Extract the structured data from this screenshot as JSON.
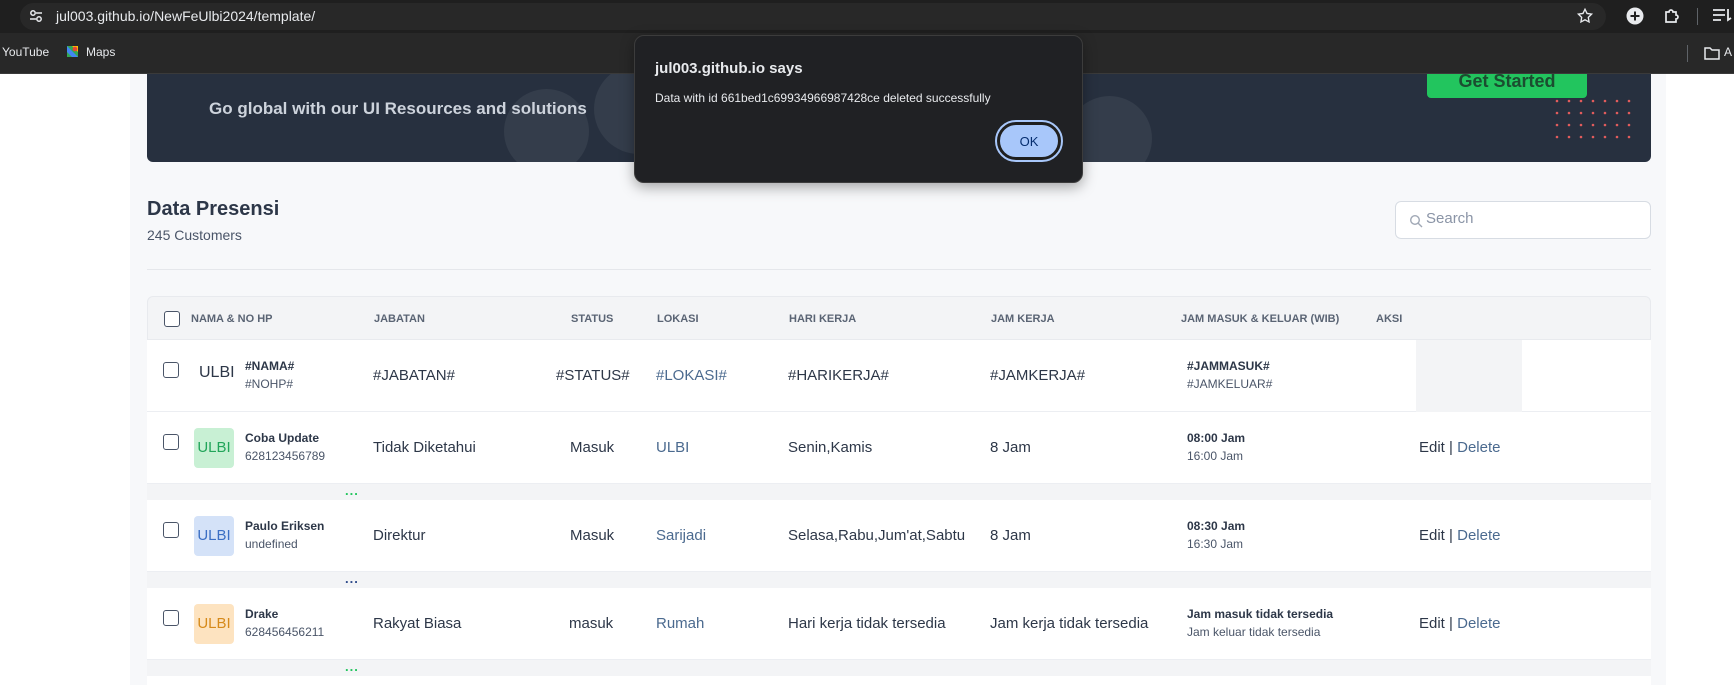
{
  "browser": {
    "url": "jul003.github.io/NewFeUlbi2024/template/",
    "bookmarks": [
      "YouTube",
      "Maps"
    ],
    "bookmark_overflow": "A"
  },
  "banner": {
    "text": "Go global with our UI Resources and solutions",
    "button_label": "Get Started"
  },
  "header": {
    "title": "Data Presensi",
    "subtitle": "245 Customers",
    "search_placeholder": "Search"
  },
  "table": {
    "columns": [
      "NAMA & NO HP",
      "JABATAN",
      "STATUS",
      "LOKASI",
      "HARI KERJA",
      "JAM KERJA",
      "JAM MASUK & KELUAR (WIB)",
      "AKSI"
    ],
    "template_row": {
      "avatar": "ULBI",
      "nama": "#NAMA#",
      "nohp": "#NOHP#",
      "jabatan": "#JABATAN#",
      "status": "#STATUS#",
      "lokasi": "#LOKASI#",
      "hari_kerja": "#HARIKERJA#",
      "jam_kerja": "#JAMKERJA#",
      "jam_masuk": "#JAMMASUK#",
      "jam_keluar": "#JAMKELUAR#"
    },
    "rows": [
      {
        "avatar": "ULBI",
        "nama": "Coba Update",
        "nohp": "628123456789",
        "jabatan": "Tidak Diketahui",
        "status": "Masuk",
        "lokasi": "ULBI",
        "hari_kerja": "Senin,Kamis",
        "jam_kerja": "8 Jam",
        "jam_masuk": "08:00 Jam",
        "jam_keluar": "16:00 Jam",
        "edit": "Edit",
        "separator": "|",
        "delete": "Delete"
      },
      {
        "avatar": "ULBI",
        "nama": "Paulo Eriksen",
        "nohp": "undefined",
        "jabatan": "Direktur",
        "status": "Masuk",
        "lokasi": "Sarijadi",
        "hari_kerja": "Selasa,Rabu,Jum'at,Sabtu",
        "jam_kerja": "8 Jam",
        "jam_masuk": "08:30 Jam",
        "jam_keluar": "16:30 Jam",
        "edit": "Edit",
        "separator": "|",
        "delete": "Delete"
      },
      {
        "avatar": "ULBI",
        "nama": "Drake",
        "nohp": "628456456211",
        "jabatan": "Rakyat Biasa",
        "status": "masuk",
        "lokasi": "Rumah",
        "hari_kerja": "Hari kerja tidak tersedia",
        "jam_kerja": "Jam kerja tidak tersedia",
        "jam_masuk": "Jam masuk tidak tersedia",
        "jam_keluar": "Jam keluar tidak tersedia",
        "edit": "Edit",
        "separator": "|",
        "delete": "Delete"
      }
    ],
    "more_dots": "...",
    "colors": {
      "avatar_green_bg": "#c8f0d4",
      "avatar_green_text": "#22a55a",
      "avatar_blue_bg": "#d4e2f8",
      "avatar_blue_text": "#3b6fc4",
      "avatar_orange_bg": "#fde3c0",
      "avatar_orange_text": "#d68a1a",
      "dots_green": "#22c55e",
      "dots_blue": "#2d4a8a"
    }
  },
  "dialog": {
    "title": "jul003.github.io says",
    "message": "Data with id 661bed1c69934966987428ce deleted successfully",
    "ok_label": "OK"
  }
}
